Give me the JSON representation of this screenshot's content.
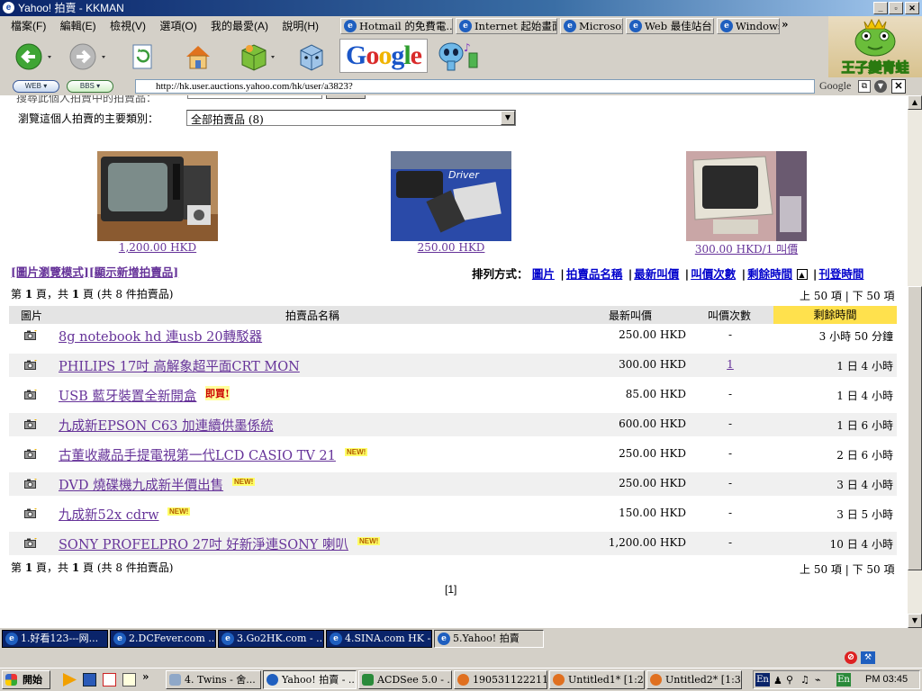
{
  "window": {
    "title": "Yahoo! 拍賣 - KKMAN"
  },
  "menu": [
    "檔案(F)",
    "編輯(E)",
    "檢視(V)",
    "選項(O)",
    "我的最愛(A)",
    "說明(H)"
  ],
  "links_bar": [
    "Hotmail 的免費電...",
    "Internet 起始畫面",
    "Microsoft",
    "Web 最佳站台",
    "Windows"
  ],
  "toolbar": {
    "web_btn": "WEB",
    "bbs_btn": "BBS",
    "google_logo": "Google"
  },
  "address": {
    "url": "http://hk.user.auctions.yahoo.com/hk/user/a3823?",
    "search_label": "Google"
  },
  "frog_banner": "王子變青蛙",
  "page": {
    "category_label": "瀏覽這個人拍賣的主要類別：",
    "category_value": "全部拍賣品 (8)",
    "top_partial_label": "搜尋此個人拍賣中的拍賣品：",
    "featured": [
      {
        "price": "1,200.00 HKD",
        "thumb": "crt-television"
      },
      {
        "price": "250.00 HKD",
        "thumb": "hard-drive-adapter"
      },
      {
        "price": "300.00 HKD/1 叫價",
        "thumb": "crt-monitor"
      }
    ],
    "view_links": [
      "[圖片瀏覽模式]",
      "[顯示新增拍賣品]"
    ],
    "sort_label": "排列方式：",
    "sort_links": [
      "圖片",
      "拍賣品名稱",
      "最新叫價",
      "叫價次數",
      "剩餘時間",
      "刊登時間"
    ],
    "page_info_prefix": "第 ",
    "page_info_num": "1",
    "page_info_mid": " 頁，共 ",
    "page_info_total": "1",
    "page_info_suffix": " 頁 (共 8 件拍賣品)",
    "prev_50": "上 50 項",
    "next_50": "下 50 項",
    "columns": {
      "image": "圖片",
      "name": "拍賣品名稱",
      "price": "最新叫價",
      "bids": "叫價次數",
      "time": "剩餘時間"
    },
    "rows": [
      {
        "name": "8g notebook hd 連usb 20轉駁器",
        "tag": "",
        "price": "250.00 HKD",
        "bids": "-",
        "bids_link": false,
        "time": "3 小時 50 分鐘"
      },
      {
        "name": "PHILIPS 17吋 高解象超平面CRT MON",
        "tag": "",
        "price": "300.00 HKD",
        "bids": "1",
        "bids_link": true,
        "time": "1 日 4 小時"
      },
      {
        "name": "USB 藍牙裝置全新開盒",
        "tag": "即買!",
        "price": "85.00 HKD",
        "bids": "-",
        "bids_link": false,
        "time": "1 日 4 小時"
      },
      {
        "name": "九成新EPSON C63 加連續供墨係統",
        "tag": "",
        "price": "600.00 HKD",
        "bids": "-",
        "bids_link": false,
        "time": "1 日 6 小時"
      },
      {
        "name": "古董收藏品手提電視第一代LCD CASIO TV 21",
        "tag": "NEW!",
        "price": "250.00 HKD",
        "bids": "-",
        "bids_link": false,
        "time": "2 日 6 小時"
      },
      {
        "name": "DVD 燒碟機九成新半價出售",
        "tag": "NEW!",
        "price": "250.00 HKD",
        "bids": "-",
        "bids_link": false,
        "time": "3 日 4 小時"
      },
      {
        "name": "九成新52x cdrw",
        "tag": "NEW!",
        "price": "150.00 HKD",
        "bids": "-",
        "bids_link": false,
        "time": "3 日 5 小時"
      },
      {
        "name": "SONY PROFELPRO 27吋 好新淨連SONY 喇叭",
        "tag": "NEW!",
        "price": "1,200.00 HKD",
        "bids": "-",
        "bids_link": false,
        "time": "10 日 4 小時"
      }
    ],
    "pager": "[1]"
  },
  "browser_tabs": [
    "1.好看123---网...",
    "2.DCFever.com ...",
    "3.Go2HK.com - ...",
    "4.SINA.com HK - ...",
    "5.Yahoo! 拍賣"
  ],
  "taskbar": {
    "start": "開始",
    "tasks": [
      "4. Twins - 舍...",
      "Yahoo! 拍賣 - ...",
      "ACDSee 5.0 - ...",
      "190531122211...",
      "Untitled1* [1:2...",
      "Untitled2* [1:3..."
    ],
    "lang": "En",
    "lang2": "En",
    "clock": "PM 03:45"
  },
  "colors": {
    "visited_link": "#663399",
    "title_bar": "#0a246a",
    "highlight_header": "#ffe14d",
    "row_stripe": "#f0f0f0"
  }
}
